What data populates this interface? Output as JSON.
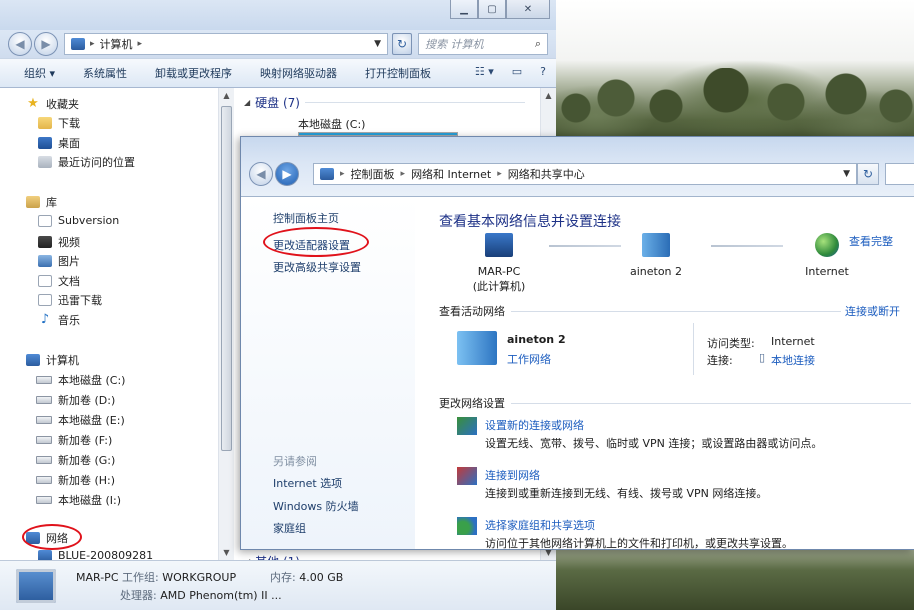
{
  "explorer": {
    "address_crumbs": [
      "计算机"
    ],
    "search_placeholder": "搜索 计算机",
    "toolbar": [
      "组织 ▾",
      "系统属性",
      "卸载或更改程序",
      "映射网络驱动器",
      "打开控制面板"
    ],
    "nav": {
      "favorites": {
        "label": "收藏夹",
        "items": [
          "下载",
          "桌面",
          "最近访问的位置"
        ]
      },
      "libraries": {
        "label": "库",
        "items": [
          "Subversion",
          "视频",
          "图片",
          "文档",
          "迅雷下载",
          "音乐"
        ]
      },
      "computer": {
        "label": "计算机",
        "drives": [
          "本地磁盘 (C:)",
          "新加卷 (D:)",
          "本地磁盘 (E:)",
          "新加卷 (F:)",
          "新加卷 (G:)",
          "新加卷 (H:)",
          "本地磁盘 (I:)"
        ]
      },
      "network": {
        "label": "网络",
        "items": [
          "BLUE-200809281"
        ]
      }
    },
    "content": {
      "group_hdd": "硬盘 (7)",
      "first_drive": "本地磁盘 (C:)",
      "group_other": "其他 (1)"
    },
    "details": {
      "pc_name": "MAR-PC",
      "workgroup_label": "工作组:",
      "workgroup_value": "WORKGROUP",
      "memory_label": "内存:",
      "memory_value": "4.00 GB",
      "cpu_label": "处理器:",
      "cpu_value": "AMD Phenom(tm) II ..."
    }
  },
  "control_panel": {
    "breadcrumbs": [
      "控制面板",
      "网络和 Internet",
      "网络和共享中心"
    ],
    "left_links": [
      "控制面板主页",
      "更改适配器设置",
      "更改高级共享设置"
    ],
    "see_also_label": "另请参阅",
    "see_also": [
      "Internet 选项",
      "Windows 防火墙",
      "家庭组"
    ],
    "title": "查看基本网络信息并设置连接",
    "view_full_map": "查看完整",
    "map": {
      "node1_name": "MAR-PC",
      "node1_sub": "(此计算机)",
      "node2_name": "aineton  2",
      "node3_name": "Internet"
    },
    "active_networks_head": "查看活动网络",
    "connect_disconnect": "连接或断开",
    "active_network": {
      "name": "aineton  2",
      "type": "工作网络",
      "access_label": "访问类型:",
      "access_value": "Internet",
      "conn_label": "连接:",
      "conn_value": "本地连接"
    },
    "change_settings_head": "更改网络设置",
    "tasks": [
      {
        "link": "设置新的连接或网络",
        "desc": "设置无线、宽带、拨号、临时或 VPN 连接；或设置路由器或访问点。"
      },
      {
        "link": "连接到网络",
        "desc": "连接到或重新连接到无线、有线、拨号或 VPN 网络连接。"
      },
      {
        "link": "选择家庭组和共享选项",
        "desc": "访问位于其他网络计算机上的文件和打印机，或更改共享设置。"
      }
    ]
  },
  "colors": {
    "accent": "#1c5dbf",
    "annotation": "#e0121b",
    "heading": "#1e3287"
  }
}
